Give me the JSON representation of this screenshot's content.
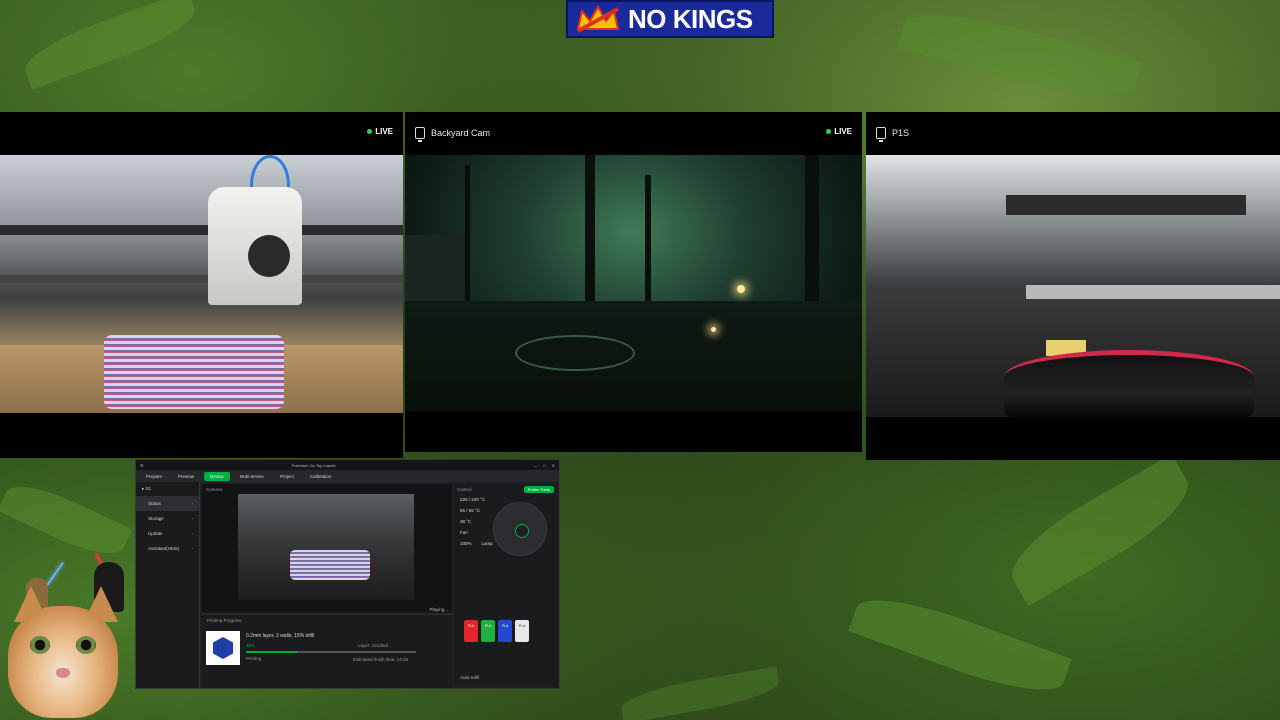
{
  "banner": {
    "text": "NO KINGS"
  },
  "cameras": [
    {
      "title": "",
      "live_label": "LIVE",
      "scene": "3D printer toolhead printing multicolor object"
    },
    {
      "title": "Backyard Cam",
      "live_label": "LIVE",
      "scene": "backyard at night"
    },
    {
      "title": "P1S",
      "live_label": "",
      "scene": "printer chamber with black bowl"
    }
  ],
  "studio": {
    "window_title": "Pokemon Go Top Loader",
    "tabs": [
      "Prepare",
      "Preview",
      "Device",
      "Multi-device",
      "Project",
      "Calibration"
    ],
    "active_tab": "Device",
    "printer_name": "X1",
    "sidebar": [
      "Status",
      "Storage",
      "Update",
      "Assistant(HMS)"
    ],
    "camera_header": "Camera",
    "playing_label": "Playing...",
    "printing_progress_label": "Printing Progress",
    "job_name": "0.2mm layer, 2 walls, 15% infill",
    "percent": "30%",
    "progress_fraction": 0.3,
    "layer": "Layer: 131/653",
    "status_text": "Printing",
    "eta": "Estimated finish time: 14:26",
    "control_header": "Control",
    "printer_parts_label": "Printer Parts",
    "temps": [
      "220 / 220 °C",
      "55 / 55 °C",
      "38 °C"
    ],
    "fan_label": "Fan",
    "fan_value": "100%",
    "lamp_label": "Lamp",
    "spools": [
      {
        "label": "PLA",
        "color": "#e02828"
      },
      {
        "label": "PLA",
        "color": "#20b040"
      },
      {
        "label": "PLA",
        "color": "#2448d0"
      },
      {
        "label": "PLA",
        "color": "#e8e8e8"
      }
    ],
    "auto_refill": "Auto-refill"
  },
  "colors": {
    "accent": "#00ae42",
    "live_dot": "#2fd35a",
    "banner_bg": "#1a2a9a"
  }
}
